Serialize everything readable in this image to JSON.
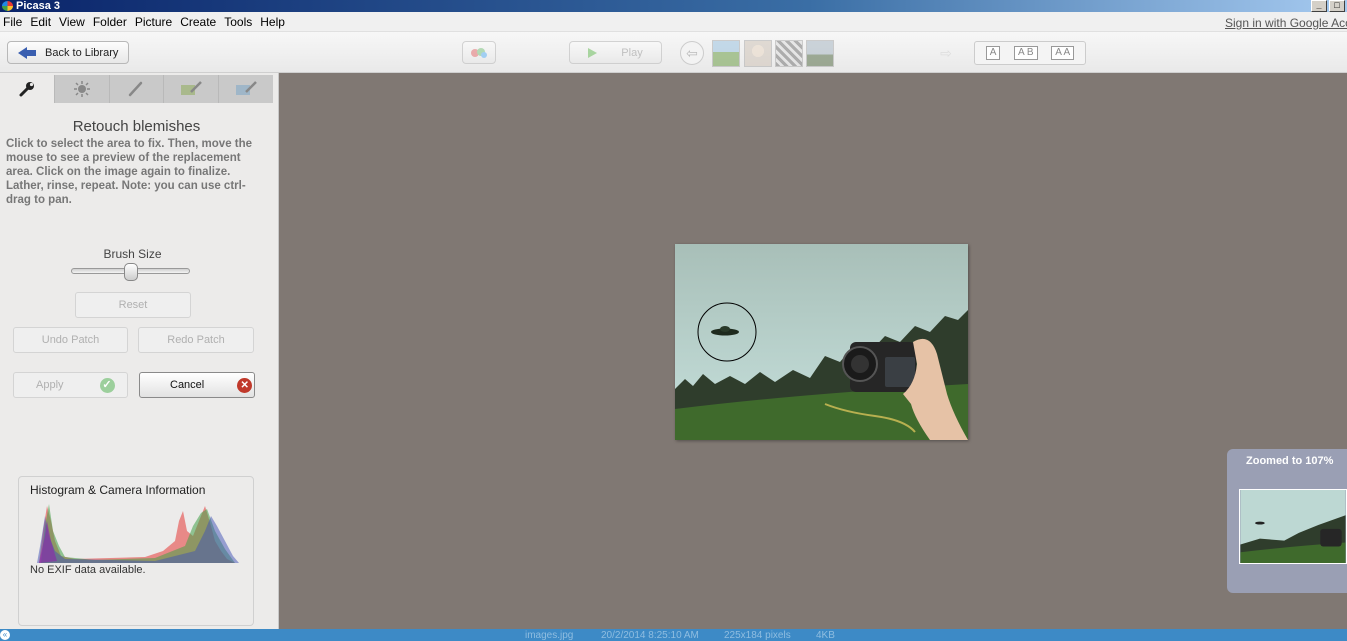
{
  "window": {
    "title": "Picasa 3",
    "controls": [
      "_",
      "□"
    ]
  },
  "menu": [
    "File",
    "Edit",
    "View",
    "Folder",
    "Picture",
    "Create",
    "Tools",
    "Help"
  ],
  "signin": {
    "label": "Sign in with Google Accou"
  },
  "toolbar": {
    "back_label": "Back to Library",
    "play_label": "Play",
    "prev_icon": "arrow-left-icon",
    "next_icon": "arrow-right-icon",
    "caption_buttons": [
      "A",
      "A B",
      "A A"
    ]
  },
  "tabs": [
    "wrench-icon",
    "sun-icon",
    "brush-icon",
    "effects-icon",
    "effects-more-icon"
  ],
  "panel": {
    "title": "Retouch blemishes",
    "instructions": "Click to select the area to fix.  Then, move the mouse to see a preview of the replacement area.  Click on the image again to finalize.  Lather, rinse, repeat.  Note:  you can use ctrl-drag to pan.",
    "brush_size_label": "Brush Size",
    "brush_size_value": 0.5,
    "reset_label": "Reset",
    "undo_label": "Undo Patch",
    "redo_label": "Redo Patch",
    "apply_label": "Apply",
    "cancel_label": "Cancel"
  },
  "histogram": {
    "title": "Histogram & Camera Information",
    "exif": "No EXIF data available."
  },
  "zoom": {
    "label": "Zoomed to 107%"
  },
  "statusbar": {
    "filename": "images.jpg",
    "date": "20/2/2014 8:25:10 AM",
    "dimensions": "225x184 pixels",
    "size": "4KB"
  },
  "colors": {
    "canvas": "#807873",
    "panel": "#ecebea",
    "statusbar": "#3d8ac6",
    "zoom_panel": "#9a9fb4"
  }
}
